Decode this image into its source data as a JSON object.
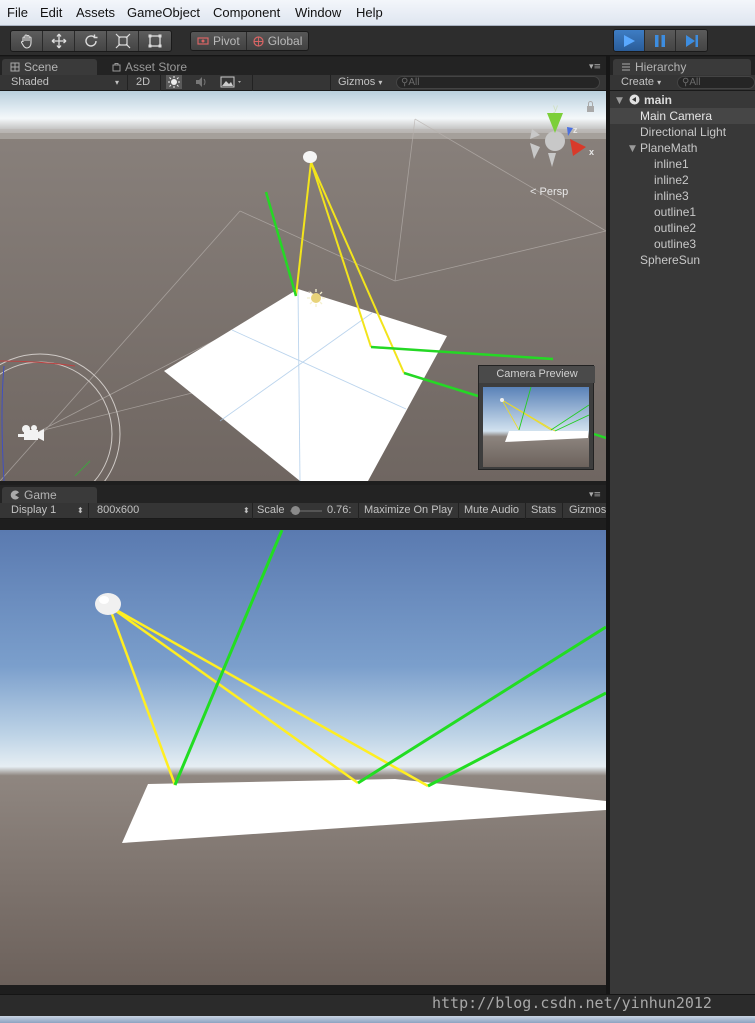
{
  "menu": [
    "File",
    "Edit",
    "Assets",
    "GameObject",
    "Component",
    "Window",
    "Help"
  ],
  "toolbar": {
    "pivot_label": "Pivot",
    "global_label": "Global"
  },
  "scene_panel": {
    "tab_scene": "Scene",
    "tab_asset_store": "Asset Store",
    "shading_mode": "Shaded",
    "mode_2d": "2D",
    "gizmos_label": "Gizmos",
    "search_placeholder": "All",
    "persp_label": "Persp",
    "axis_y": "y",
    "axis_z": "z",
    "axis_x": "x",
    "camera_preview_title": "Camera Preview"
  },
  "game_panel": {
    "tab_game": "Game",
    "display": "Display 1",
    "resolution": "800x600",
    "scale_label": "Scale",
    "scale_value": "0.76:",
    "maximize_on_play": "Maximize On Play",
    "mute_audio": "Mute Audio",
    "stats": "Stats",
    "gizmos": "Gizmos"
  },
  "hierarchy": {
    "tab_label": "Hierarchy",
    "create_label": "Create",
    "search_placeholder": "All",
    "scene_name": "main",
    "items": [
      {
        "label": "Main Camera"
      },
      {
        "label": "Directional Light"
      },
      {
        "label": "PlaneMath"
      },
      {
        "label": "inline1"
      },
      {
        "label": "inline2"
      },
      {
        "label": "inline3"
      },
      {
        "label": "outline1"
      },
      {
        "label": "outline2"
      },
      {
        "label": "outline3"
      },
      {
        "label": "SphereSun"
      }
    ]
  },
  "watermark": "http://blog.csdn.net/yinhun2012",
  "colors": {
    "ray_in": "#ffee33",
    "ray_out": "#22dd22",
    "play_accent": "#3d8de0"
  }
}
